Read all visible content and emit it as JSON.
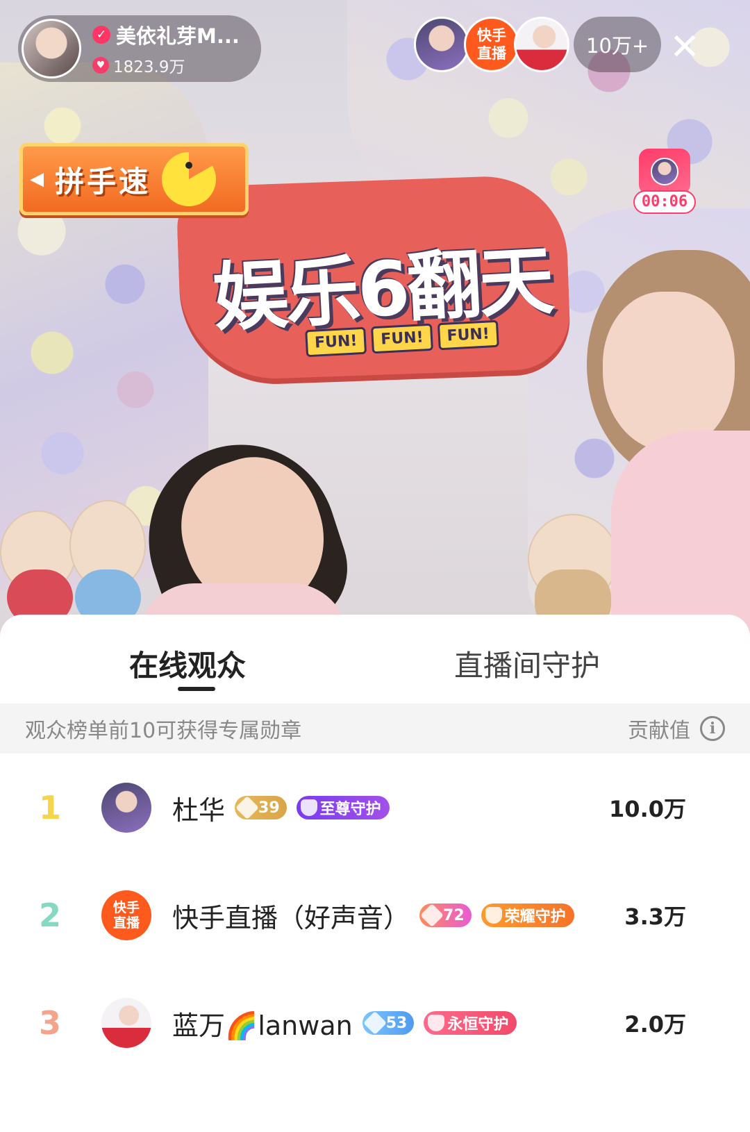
{
  "live": {
    "host_name": "美依礼芽M...",
    "host_likes": "1823.9万",
    "viewer_count": "10万+",
    "game_label": "拼手速",
    "timer": "00:06",
    "sign_title": "娱乐6翻天",
    "sign_sub": [
      "FUN!",
      "FUN!",
      "FUN!"
    ],
    "kuaishou_avatar_line1": "快手",
    "kuaishou_avatar_line2": "直播"
  },
  "sheet": {
    "tabs": [
      "在线观众",
      "直播间守护"
    ],
    "notice": "观众榜单前10可获得专属勋章",
    "contribution_label": "贡献值",
    "rows": [
      {
        "rank": "1",
        "name": "杜华",
        "level": "39",
        "guard": "至尊守护",
        "score": "10.0万"
      },
      {
        "rank": "2",
        "name": "快手直播（好声音）",
        "level": "72",
        "guard": "荣耀守护",
        "score": "3.3万",
        "avatar_line1": "快手",
        "avatar_line2": "直播"
      },
      {
        "rank": "3",
        "name": "蓝万🌈lanwan",
        "level": "53",
        "guard": "永恒守护",
        "score": "2.0万"
      }
    ]
  }
}
